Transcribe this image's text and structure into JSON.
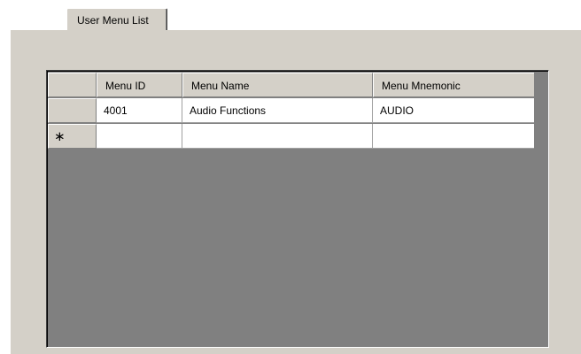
{
  "tab": {
    "label": "User Menu List"
  },
  "grid": {
    "columns": [
      "Menu ID",
      "Menu Name",
      "Menu Mnemonic"
    ],
    "rows": [
      [
        "4001",
        "Audio Functions",
        "AUDIO"
      ]
    ],
    "new_row_marker": "∗"
  }
}
